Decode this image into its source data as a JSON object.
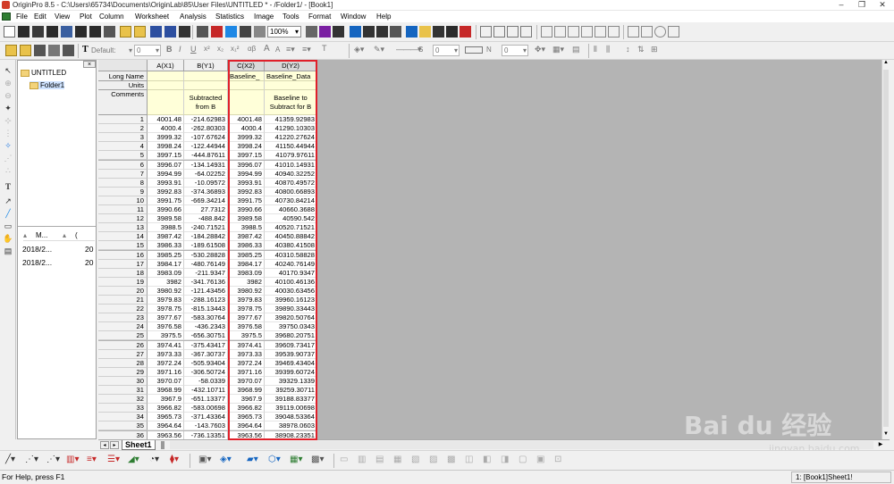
{
  "window": {
    "title": "OriginPro 8.5 - C:\\Users\\65734\\Documents\\OriginLab\\85\\User Files\\UNTITLED * - /Folder1/ - [Book1]",
    "minimize": "–",
    "restore": "❐",
    "close": "✕"
  },
  "menu": [
    "File",
    "Edit",
    "View",
    "Plot",
    "Column",
    "Worksheet",
    "Analysis",
    "Statistics",
    "Image",
    "Tools",
    "Format",
    "Window",
    "Help"
  ],
  "toolbar": {
    "zoom_value": "100%",
    "font_name": "Default:",
    "font_size": "0",
    "bold": "B",
    "italic": "I",
    "underline": "U",
    "sup": "x²",
    "sub": "x₂",
    "supsub": "x₁²",
    "greek": "αβ",
    "bigger": "A",
    "smaller": "A",
    "text_tool": "T",
    "line_width": "0",
    "size_s": "S",
    "size_n": "N",
    "pt_size": "0"
  },
  "project_explorer": {
    "root": "UNTITLED",
    "folder": "Folder1",
    "col_name": "M...",
    "col_date_marker": "(",
    "files": [
      {
        "name": "2018/2...",
        "tail": "20"
      },
      {
        "name": "2018/2...",
        "tail": "20"
      }
    ]
  },
  "worksheet": {
    "row_labels": [
      "Long Name",
      "Units",
      "Comments"
    ],
    "columns": [
      {
        "name": "A(X1)",
        "long_name": "",
        "units": "",
        "comment": ""
      },
      {
        "name": "B(Y1)",
        "long_name": "",
        "units": "",
        "comment": "Subtracted from B"
      },
      {
        "name": "C(X2)",
        "long_name": "Baseline_",
        "units": "",
        "comment": ""
      },
      {
        "name": "D(Y2)",
        "long_name": "Baseline_Data",
        "units": "",
        "comment": "Baseline to Subtract for B"
      }
    ],
    "rows": [
      [
        "1",
        "4001.48",
        "-214.62983",
        "4001.48",
        "41359.92983"
      ],
      [
        "2",
        "4000.4",
        "-262.80303",
        "4000.4",
        "41290.10303"
      ],
      [
        "3",
        "3999.32",
        "-107.67624",
        "3999.32",
        "41220.27624"
      ],
      [
        "4",
        "3998.24",
        "-122.44944",
        "3998.24",
        "41150.44944"
      ],
      [
        "5",
        "3997.15",
        "-444.87611",
        "3997.15",
        "41079.97611"
      ],
      [
        "6",
        "3996.07",
        "-134.14931",
        "3996.07",
        "41010.14931"
      ],
      [
        "7",
        "3994.99",
        "-64.02252",
        "3994.99",
        "40940.32252"
      ],
      [
        "8",
        "3993.91",
        "-10.09572",
        "3993.91",
        "40870.49572"
      ],
      [
        "9",
        "3992.83",
        "-374.36893",
        "3992.83",
        "40800.66893"
      ],
      [
        "10",
        "3991.75",
        "-669.34214",
        "3991.75",
        "40730.84214"
      ],
      [
        "11",
        "3990.66",
        "27.7312",
        "3990.66",
        "40660.3688"
      ],
      [
        "12",
        "3989.58",
        "-488.842",
        "3989.58",
        "40590.542"
      ],
      [
        "13",
        "3988.5",
        "-240.71521",
        "3988.5",
        "40520.71521"
      ],
      [
        "14",
        "3987.42",
        "-184.28842",
        "3987.42",
        "40450.88842"
      ],
      [
        "15",
        "3986.33",
        "-189.61508",
        "3986.33",
        "40380.41508"
      ],
      [
        "16",
        "3985.25",
        "-530.28828",
        "3985.25",
        "40310.58828"
      ],
      [
        "17",
        "3984.17",
        "-480.76149",
        "3984.17",
        "40240.76149"
      ],
      [
        "18",
        "3983.09",
        "-211.9347",
        "3983.09",
        "40170.9347"
      ],
      [
        "19",
        "3982",
        "-341.76136",
        "3982",
        "40100.46136"
      ],
      [
        "20",
        "3980.92",
        "-121.43456",
        "3980.92",
        "40030.63456"
      ],
      [
        "21",
        "3979.83",
        "-288.16123",
        "3979.83",
        "39960.16123"
      ],
      [
        "22",
        "3978.75",
        "-815.13443",
        "3978.75",
        "39890.33443"
      ],
      [
        "23",
        "3977.67",
        "-583.30764",
        "3977.67",
        "39820.50764"
      ],
      [
        "24",
        "3976.58",
        "-436.2343",
        "3976.58",
        "39750.0343"
      ],
      [
        "25",
        "3975.5",
        "-656.30751",
        "3975.5",
        "39680.20751"
      ],
      [
        "26",
        "3974.41",
        "-375.43417",
        "3974.41",
        "39609.73417"
      ],
      [
        "27",
        "3973.33",
        "-367.30737",
        "3973.33",
        "39539.90737"
      ],
      [
        "28",
        "3972.24",
        "-505.93404",
        "3972.24",
        "39469.43404"
      ],
      [
        "29",
        "3971.16",
        "-306.50724",
        "3971.16",
        "39399.60724"
      ],
      [
        "30",
        "3970.07",
        "-58.0339",
        "3970.07",
        "39329.1339"
      ],
      [
        "31",
        "3968.99",
        "-432.10711",
        "3968.99",
        "39259.30711"
      ],
      [
        "32",
        "3967.9",
        "-651.13377",
        "3967.9",
        "39188.83377"
      ],
      [
        "33",
        "3966.82",
        "-583.00698",
        "3966.82",
        "39119.00698"
      ],
      [
        "34",
        "3965.73",
        "-371.43364",
        "3965.73",
        "39048.53364"
      ],
      [
        "35",
        "3964.64",
        "-143.7603",
        "3964.64",
        "38978.0603"
      ],
      [
        "36",
        "3963.56",
        "-736.13351",
        "3963.56",
        "38908.23351"
      ]
    ],
    "sheet_tab": "Sheet1"
  },
  "watermark": {
    "brand": "Bai du 经验",
    "url": "jingyan.baidu.com"
  },
  "status": {
    "help": "For Help, press F1",
    "right": "1: [Book1]Sheet1!"
  },
  "colors": {
    "selection_border": "#e0202a",
    "header_yellow": "#ffffd9"
  }
}
